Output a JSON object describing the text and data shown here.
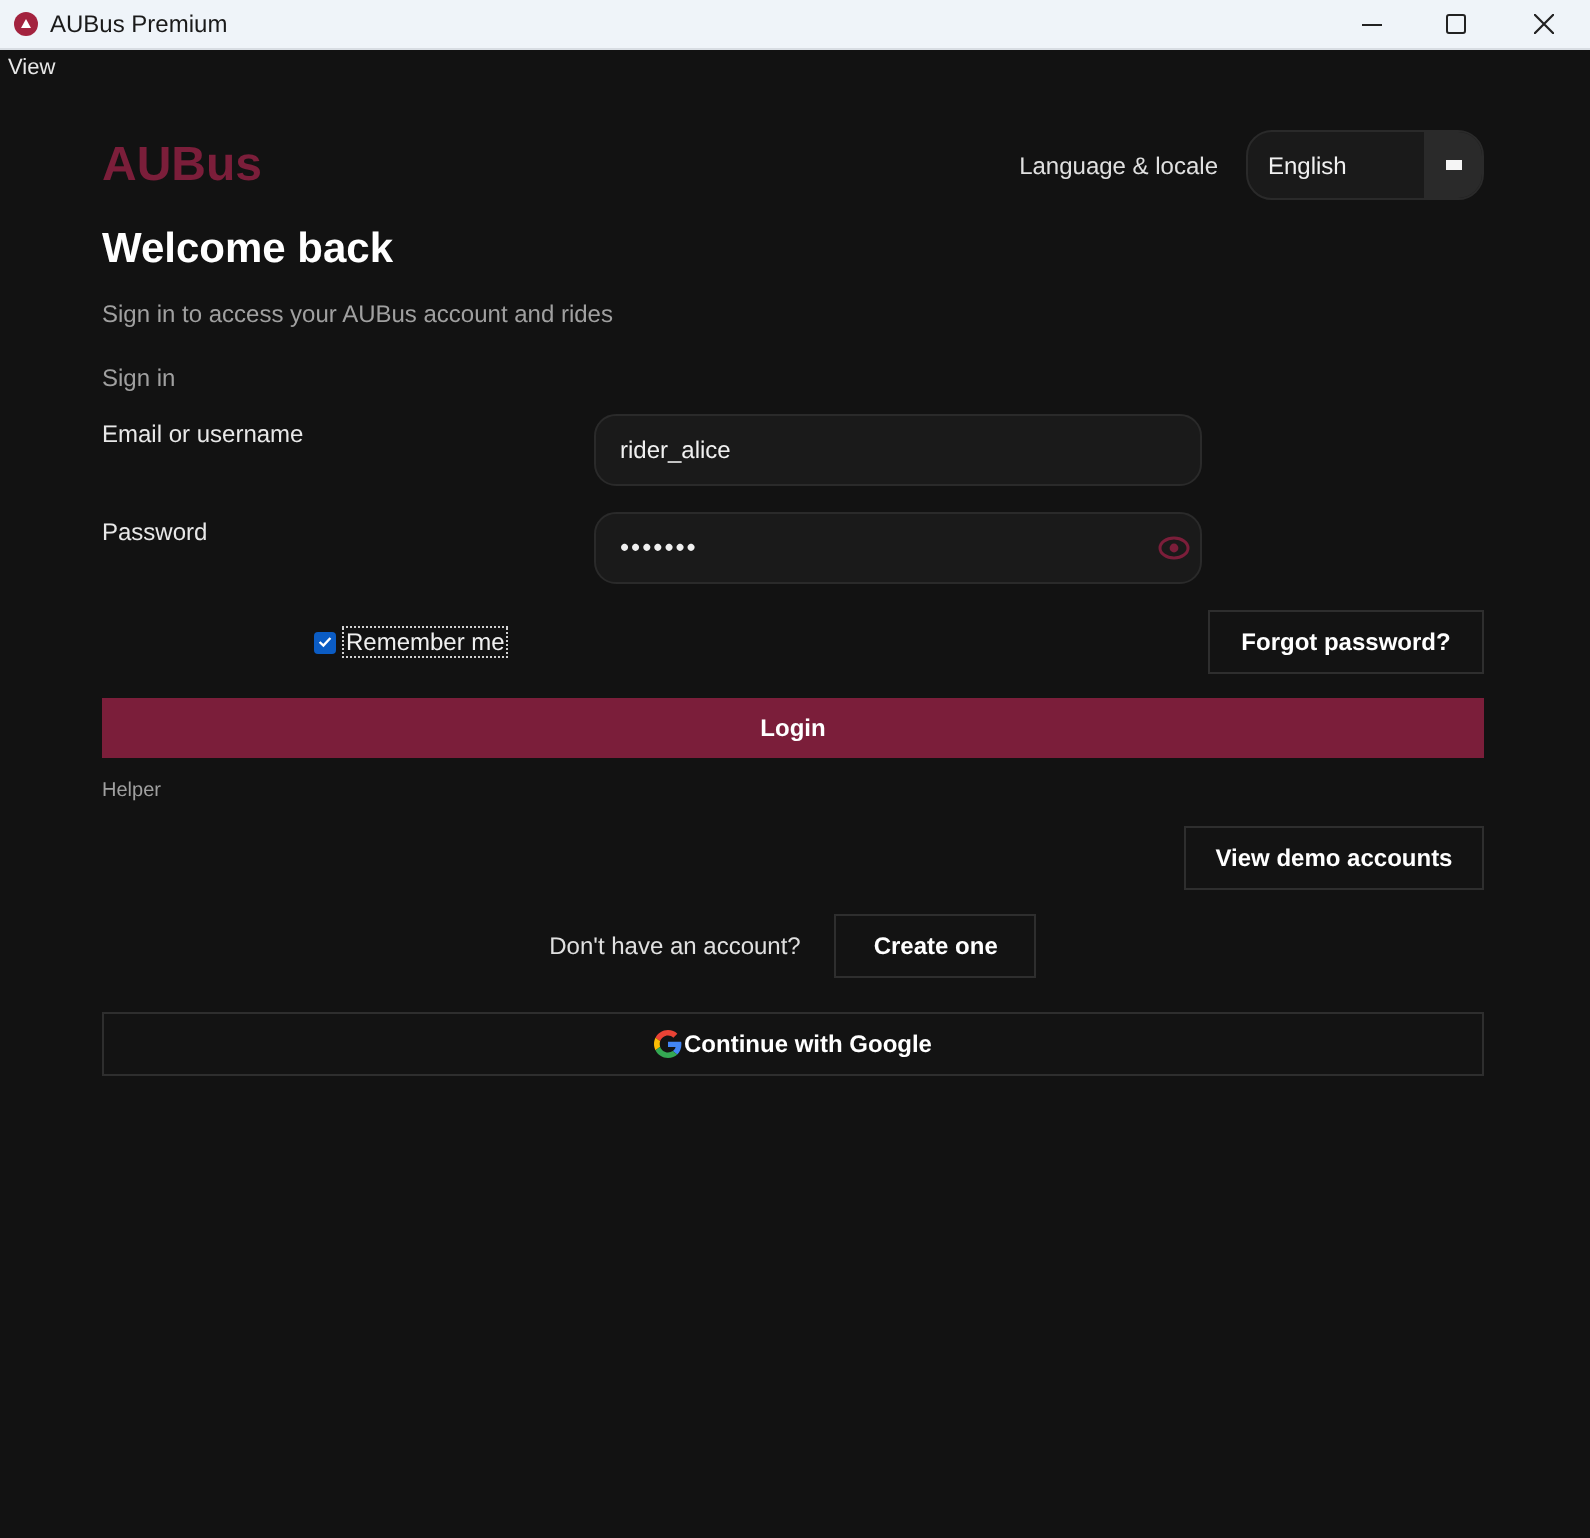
{
  "window": {
    "title": "AUBus Premium"
  },
  "menu_bar": {
    "items": [
      "View"
    ]
  },
  "header": {
    "logo": "AUBus",
    "language_label": "Language & locale",
    "language_select": {
      "value": "English"
    }
  },
  "heading": "Welcome back",
  "subtitle": "Sign in to access your AUBus account and rides",
  "section_label": "Sign in",
  "fields": [
    {
      "kind": "text",
      "label": "Email or username",
      "value": "rider_alice"
    },
    {
      "kind": "password",
      "label": "Password",
      "value": "•••••••"
    }
  ],
  "remember_me": {
    "label": "Remember me",
    "checked": true,
    "focused": true
  },
  "forgot_password_button": "Forgot password?",
  "login_button": "Login",
  "helper_label": "Helper",
  "demo_button": "View demo accounts",
  "signup": {
    "prompt": "Don't have an account?",
    "button": "Create one"
  },
  "google_button": "Continue with Google"
}
